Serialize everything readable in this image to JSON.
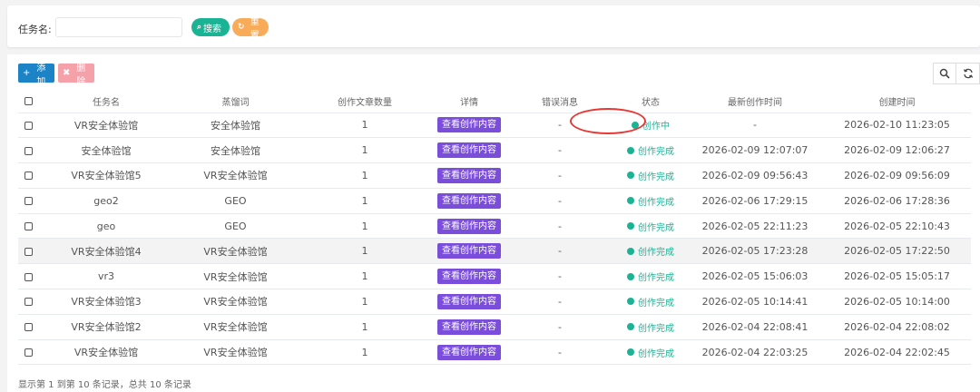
{
  "search": {
    "label": "任务名:",
    "value": "",
    "placeholder": "",
    "search_label": "搜索",
    "reset_label": "重置"
  },
  "toolbar": {
    "add_label": "添加",
    "delete_label": "删除"
  },
  "table": {
    "columns": [
      "任务名",
      "蒸馏词",
      "创作文章数量",
      "详情",
      "错误消息",
      "状态",
      "最新创作时间",
      "创建时间"
    ],
    "detail_label": "查看创作内容",
    "rows": [
      {
        "name": "VR安全体验馆",
        "keyword": "安全体验馆",
        "count": "1",
        "error": "-",
        "status": "创作中",
        "latest": "-",
        "created": "2026-02-10 11:23:05"
      },
      {
        "name": "安全体验馆",
        "keyword": "安全体验馆",
        "count": "1",
        "error": "-",
        "status": "创作完成",
        "latest": "2026-02-09 12:07:07",
        "created": "2026-02-09 12:06:27"
      },
      {
        "name": "VR安全体验馆5",
        "keyword": "VR安全体验馆",
        "count": "1",
        "error": "-",
        "status": "创作完成",
        "latest": "2026-02-09 09:56:43",
        "created": "2026-02-09 09:56:09"
      },
      {
        "name": "geo2",
        "keyword": "GEO",
        "count": "1",
        "error": "-",
        "status": "创作完成",
        "latest": "2026-02-06 17:29:15",
        "created": "2026-02-06 17:28:36"
      },
      {
        "name": "geo",
        "keyword": "GEO",
        "count": "1",
        "error": "-",
        "status": "创作完成",
        "latest": "2026-02-05 22:11:23",
        "created": "2026-02-05 22:10:43"
      },
      {
        "name": "VR安全体验馆4",
        "keyword": "VR安全体验馆",
        "count": "1",
        "error": "-",
        "status": "创作完成",
        "latest": "2026-02-05 17:23:28",
        "created": "2026-02-05 17:22:50"
      },
      {
        "name": "vr3",
        "keyword": "VR安全体验馆",
        "count": "1",
        "error": "-",
        "status": "创作完成",
        "latest": "2026-02-05 15:06:03",
        "created": "2026-02-05 15:05:17"
      },
      {
        "name": "VR安全体验馆3",
        "keyword": "VR安全体验馆",
        "count": "1",
        "error": "-",
        "status": "创作完成",
        "latest": "2026-02-05 10:14:41",
        "created": "2026-02-05 10:14:00"
      },
      {
        "name": "VR安全体验馆2",
        "keyword": "VR安全体验馆",
        "count": "1",
        "error": "-",
        "status": "创作完成",
        "latest": "2026-02-04 22:08:41",
        "created": "2026-02-04 22:08:02"
      },
      {
        "name": "VR安全体验馆",
        "keyword": "VR安全体验馆",
        "count": "1",
        "error": "-",
        "status": "创作完成",
        "latest": "2026-02-04 22:03:25",
        "created": "2026-02-04 22:02:45"
      }
    ]
  },
  "pagination": {
    "info": "显示第 1 到第 10 条记录，总共 10 条记录"
  },
  "colors": {
    "primary": "#1ab394",
    "add": "#1c84c6",
    "delete": "#ed5565",
    "reset": "#f8ac59",
    "detail": "#7a4ddb",
    "annotation": "#e53935"
  }
}
